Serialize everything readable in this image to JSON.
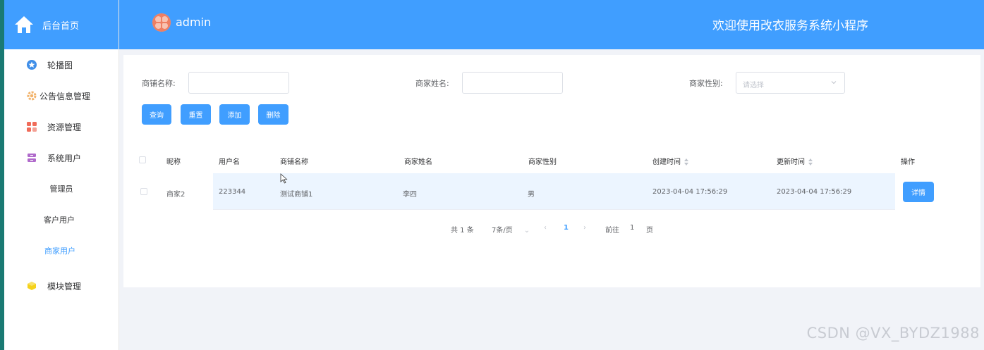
{
  "sidebar": {
    "brand_title": "后台首页",
    "items": [
      {
        "label": "轮播图",
        "icon": "star-icon"
      },
      {
        "label": "公告信息管理",
        "icon": "gear-icon"
      },
      {
        "label": "资源管理",
        "icon": "grid-icon"
      },
      {
        "label": "系统用户",
        "icon": "server-icon"
      },
      {
        "label": "管理员"
      },
      {
        "label": "客户用户"
      },
      {
        "label": "商家用户",
        "active": true
      },
      {
        "label": "模块管理",
        "icon": "cube-icon"
      }
    ]
  },
  "header": {
    "username": "admin",
    "welcome": "欢迎使用改衣服务系统小程序"
  },
  "search": {
    "shop_name_label": "商铺名称:",
    "merchant_name_label": "商家姓名:",
    "merchant_gender_label": "商家性别:",
    "gender_placeholder": "请选择"
  },
  "actions": {
    "query": "查询",
    "reset": "重置",
    "add": "添加",
    "delete": "删除"
  },
  "table": {
    "headers": [
      "昵称",
      "用户名",
      "商铺名称",
      "商家姓名",
      "商家性别",
      "创建时间",
      "更新时间",
      "操作"
    ],
    "rows": [
      {
        "nickname": "商家2",
        "username": "223344",
        "shop_name": "测试商铺1",
        "merchant_name": "李四",
        "gender": "男",
        "created": "2023-04-04 17:56:29",
        "updated": "2023-04-04 17:56:29",
        "action": "详情"
      }
    ]
  },
  "pagination": {
    "total": "共 1 条",
    "page_size": "7条/页",
    "current_page": "1",
    "goto_label": "前往",
    "goto_value": "1",
    "page_suffix": "页"
  },
  "watermark": "CSDN @VX_BYDZ1988",
  "colors": {
    "primary": "#409eff",
    "row_highlight": "#ecf5ff"
  }
}
